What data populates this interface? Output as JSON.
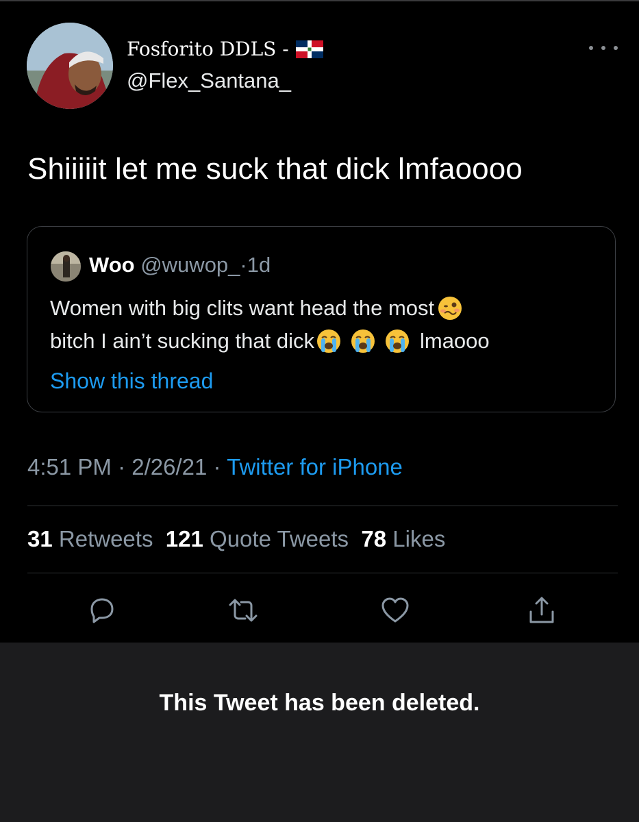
{
  "tweet": {
    "author": {
      "display_name": "Fosforito DDLS -",
      "flag_icon": "dominican-republic-flag",
      "handle": "@Flex_Santana_"
    },
    "text": "Shiiiiit let me suck that dick lmfaoooo",
    "quoted": {
      "name": "Woo",
      "handle": "@wuwop_",
      "separator": "·",
      "time": "1d",
      "line1": "Women with big clits want head the most",
      "line1_emoji": "woozy-face-emoji",
      "line2": "bitch I ain’t sucking that dick",
      "line2_emoji": "loudly-crying-face-emoji",
      "line2_suffix": "lmaooo",
      "show_thread": "Show this thread"
    },
    "meta": {
      "time": "4:51 PM",
      "sep1": "·",
      "date": "2/26/21",
      "sep2": "·",
      "source": "Twitter for iPhone"
    },
    "stats": {
      "retweets_count": "31",
      "retweets_label": "Retweets",
      "quotes_count": "121",
      "quotes_label": "Quote Tweets",
      "likes_count": "78",
      "likes_label": "Likes"
    },
    "actions": [
      "reply-icon",
      "retweet-icon",
      "like-icon",
      "share-icon"
    ]
  },
  "deleted_notice": "This Tweet has been deleted.",
  "colors": {
    "background": "#000000",
    "link": "#1d9bf0",
    "muted": "#8b98a5",
    "border": "#3d4045",
    "deleted_panel": "#1c1c1e"
  }
}
